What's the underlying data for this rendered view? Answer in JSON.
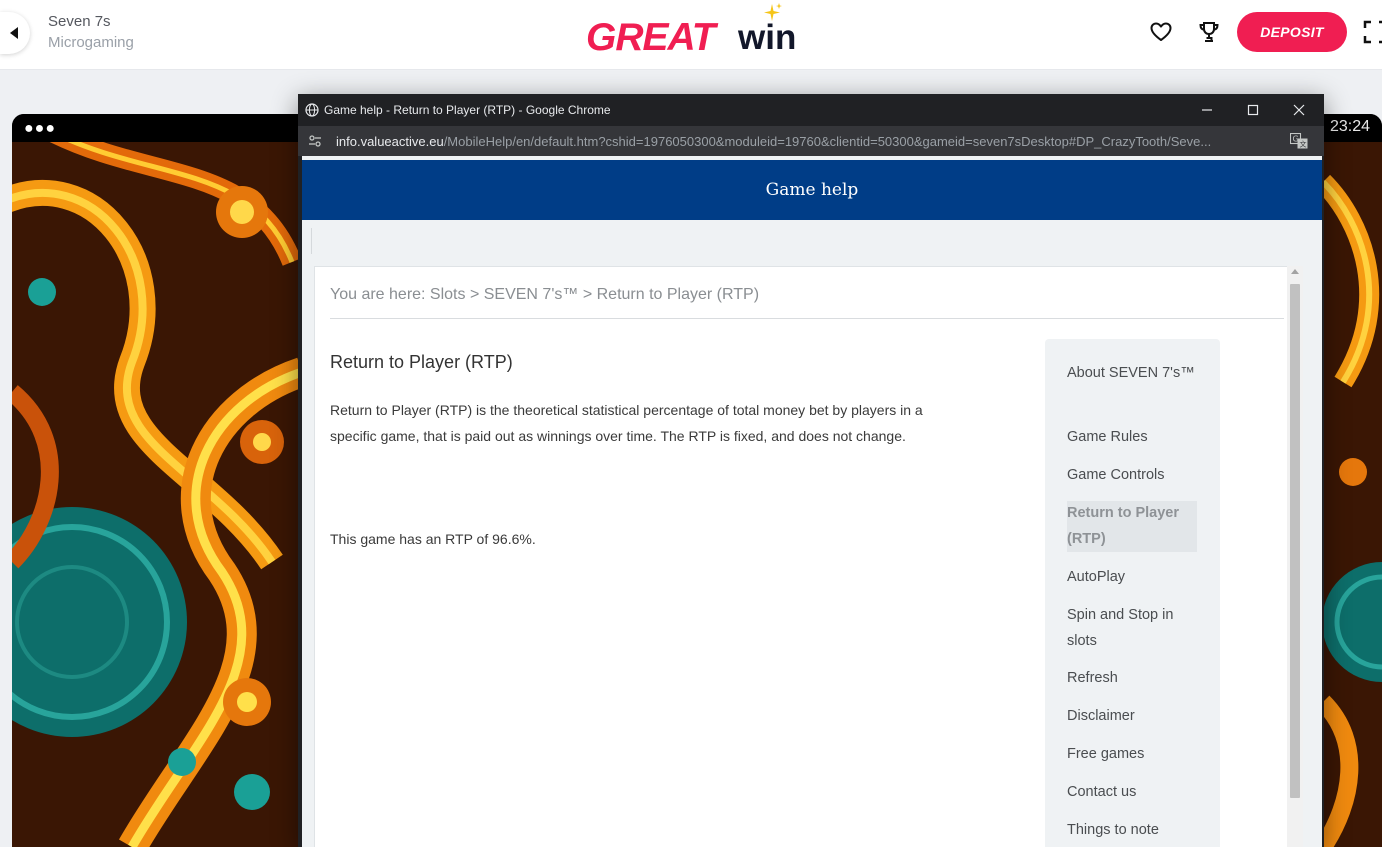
{
  "site_header": {
    "game_title": "Seven 7s",
    "game_provider": "Microgaming",
    "logo_primary": "GREAT",
    "logo_secondary": "win",
    "deposit_label": "DEPOSIT",
    "icons": [
      "back-arrow-icon",
      "heart-icon",
      "trophy-icon",
      "fullscreen-icon"
    ],
    "brand_color": "#f01e52"
  },
  "game_frame": {
    "clock": "23:24"
  },
  "chrome_window": {
    "title": "Game help - Return to Player (RTP) - Google Chrome",
    "url_domain": "info.valueactive.eu",
    "url_path": "/MobileHelp/en/default.htm?cshid=1976050300&moduleid=19760&clientid=50300&gameid=seven7sDesktop#DP_CrazyTooth/Seve..."
  },
  "help_page": {
    "header_title": "Game help",
    "header_color": "#003d87",
    "breadcrumb": "You are here: Slots > SEVEN 7's™ > Return to Player (RTP)",
    "heading": "Return to Player (RTP)",
    "body": "Return to Player (RTP) is the theoretical statistical percentage of total money bet by players in a specific game, that is paid out as winnings over time. The RTP is fixed, and does not change.",
    "rtp_statement": "This game has an RTP of 96.6%.",
    "nav": {
      "items": [
        {
          "label": "About SEVEN 7's™",
          "active": false
        },
        {
          "label": "Game Rules",
          "active": false
        },
        {
          "label": "Game Controls",
          "active": false
        },
        {
          "label": "Return to Player (RTP)",
          "active": true
        },
        {
          "label": "AutoPlay",
          "active": false
        },
        {
          "label": "Spin and Stop in slots",
          "active": false
        },
        {
          "label": "Refresh",
          "active": false
        },
        {
          "label": "Disclaimer",
          "active": false
        },
        {
          "label": "Free games",
          "active": false
        },
        {
          "label": "Contact us",
          "active": false
        },
        {
          "label": "Things to note",
          "active": false
        }
      ]
    }
  }
}
